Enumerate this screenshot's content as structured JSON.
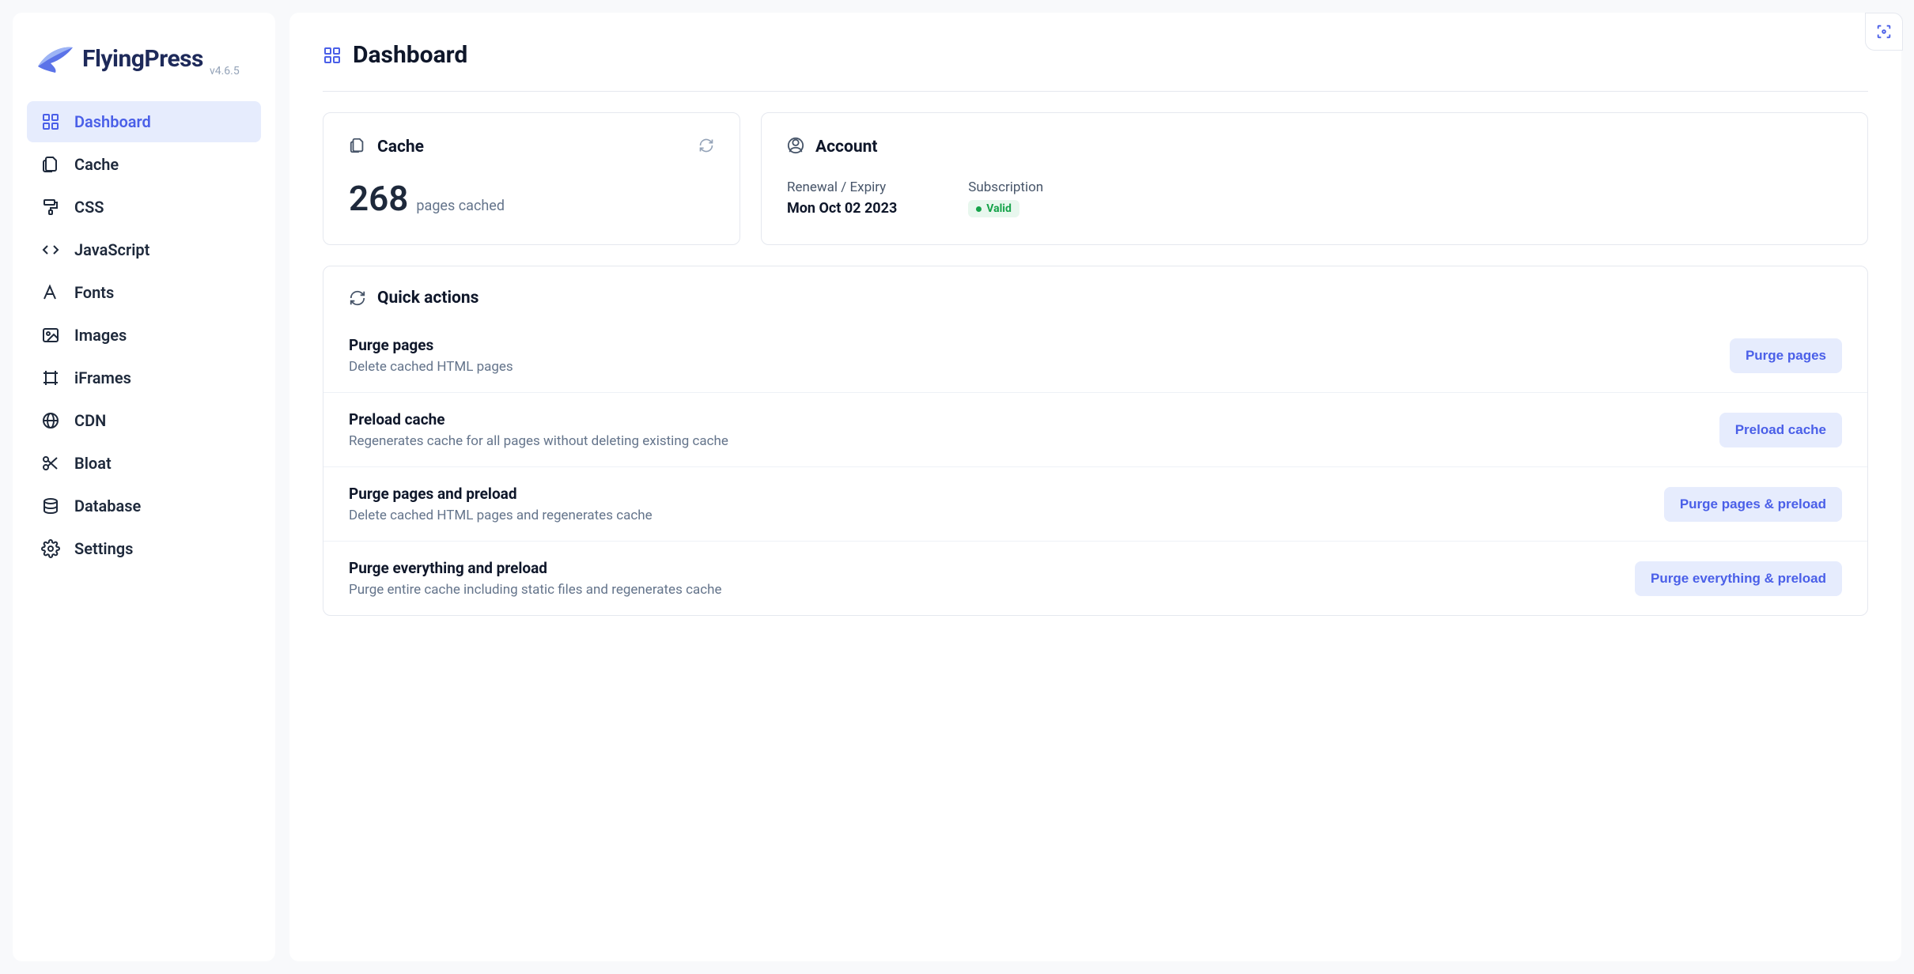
{
  "brand": {
    "name": "FlyingPress",
    "version": "v4.6.5"
  },
  "nav": [
    {
      "label": "Dashboard",
      "icon": "dashboard",
      "active": true
    },
    {
      "label": "Cache",
      "icon": "files"
    },
    {
      "label": "CSS",
      "icon": "paint-roller"
    },
    {
      "label": "JavaScript",
      "icon": "code"
    },
    {
      "label": "Fonts",
      "icon": "font"
    },
    {
      "label": "Images",
      "icon": "image"
    },
    {
      "label": "iFrames",
      "icon": "frame"
    },
    {
      "label": "CDN",
      "icon": "globe"
    },
    {
      "label": "Bloat",
      "icon": "scissors"
    },
    {
      "label": "Database",
      "icon": "database"
    },
    {
      "label": "Settings",
      "icon": "gear"
    }
  ],
  "page": {
    "title": "Dashboard"
  },
  "cache": {
    "title": "Cache",
    "count": "268",
    "label": "pages cached"
  },
  "account": {
    "title": "Account",
    "renewal_label": "Renewal / Expiry",
    "renewal_value": "Mon Oct 02 2023",
    "subscription_label": "Subscription",
    "subscription_status": "Valid"
  },
  "quick_actions": {
    "title": "Quick actions",
    "items": [
      {
        "title": "Purge pages",
        "desc": "Delete cached HTML pages",
        "button": "Purge pages"
      },
      {
        "title": "Preload cache",
        "desc": "Regenerates cache for all pages without deleting existing cache",
        "button": "Preload cache"
      },
      {
        "title": "Purge pages and preload",
        "desc": "Delete cached HTML pages and regenerates cache",
        "button": "Purge pages & preload"
      },
      {
        "title": "Purge everything and preload",
        "desc": "Purge entire cache including static files and regenerates cache",
        "button": "Purge everything & preload"
      }
    ]
  }
}
